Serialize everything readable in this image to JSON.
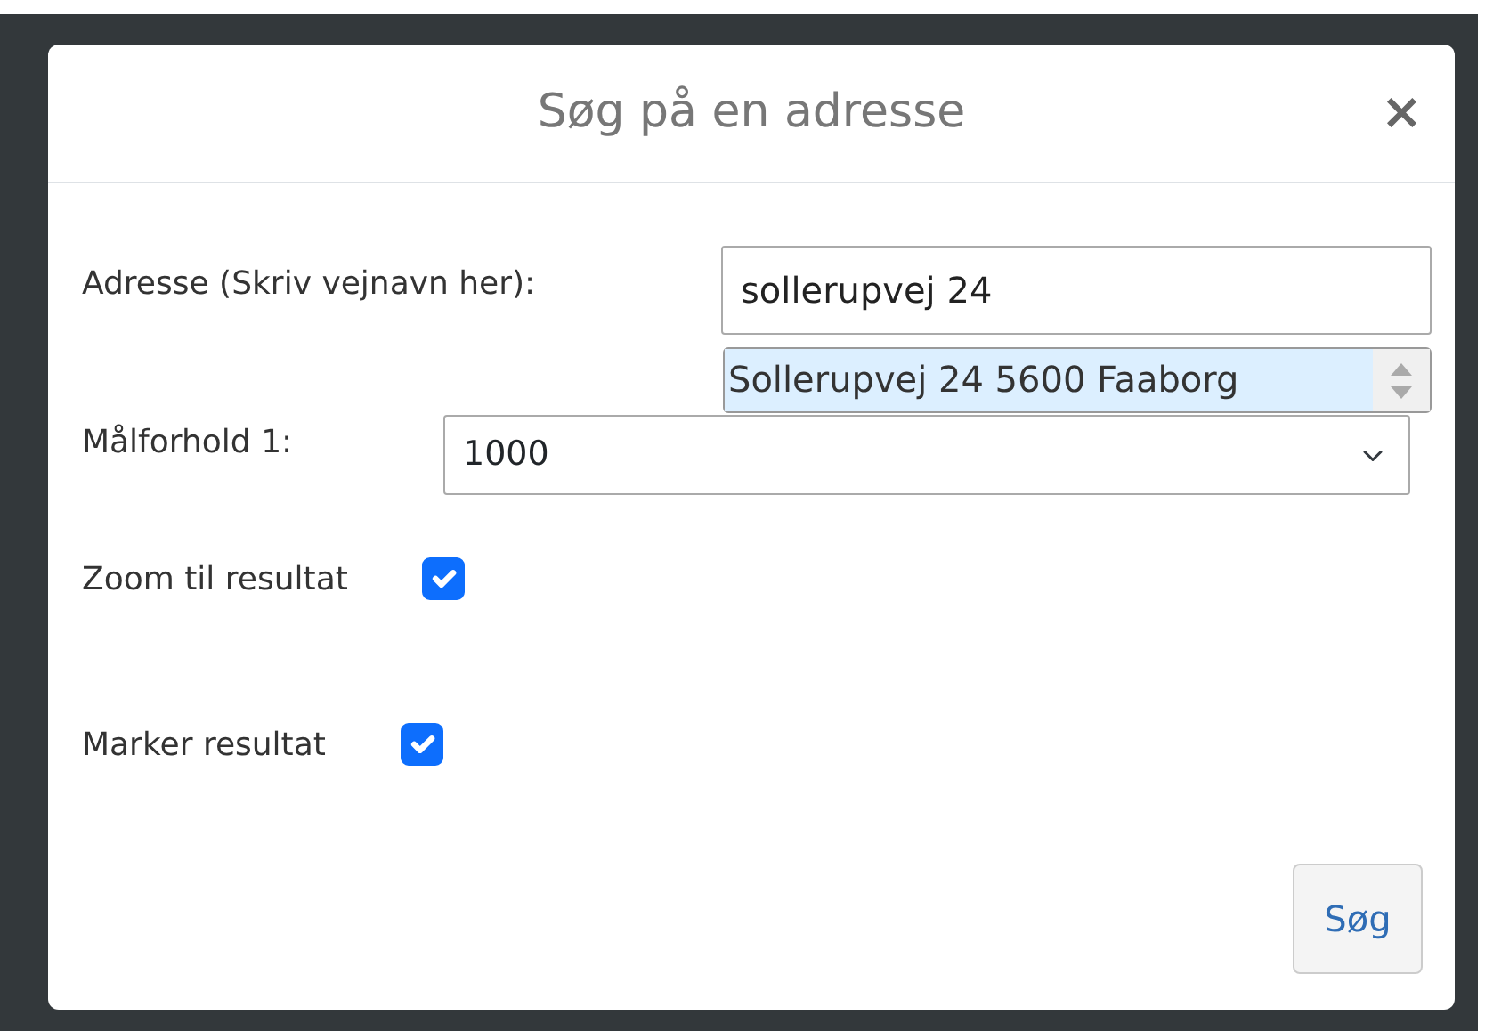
{
  "dialog": {
    "title": "Søg på en adresse",
    "close": "×"
  },
  "fields": [
    {
      "kind": "text",
      "label": "Adresse (Skriv vejnavn her):",
      "value": "sollerupvej 24",
      "suggestions": [
        {
          "text": "Sollerupvej 24 5600 Faaborg",
          "selected": true
        }
      ]
    },
    {
      "kind": "select",
      "label": "Målforhold 1:",
      "value": "1000"
    },
    {
      "kind": "checkbox",
      "label": "Zoom til resultat",
      "checked": true
    },
    {
      "kind": "checkbox",
      "label": "Marker resultat",
      "checked": true
    }
  ],
  "buttons": [
    "Søg"
  ]
}
